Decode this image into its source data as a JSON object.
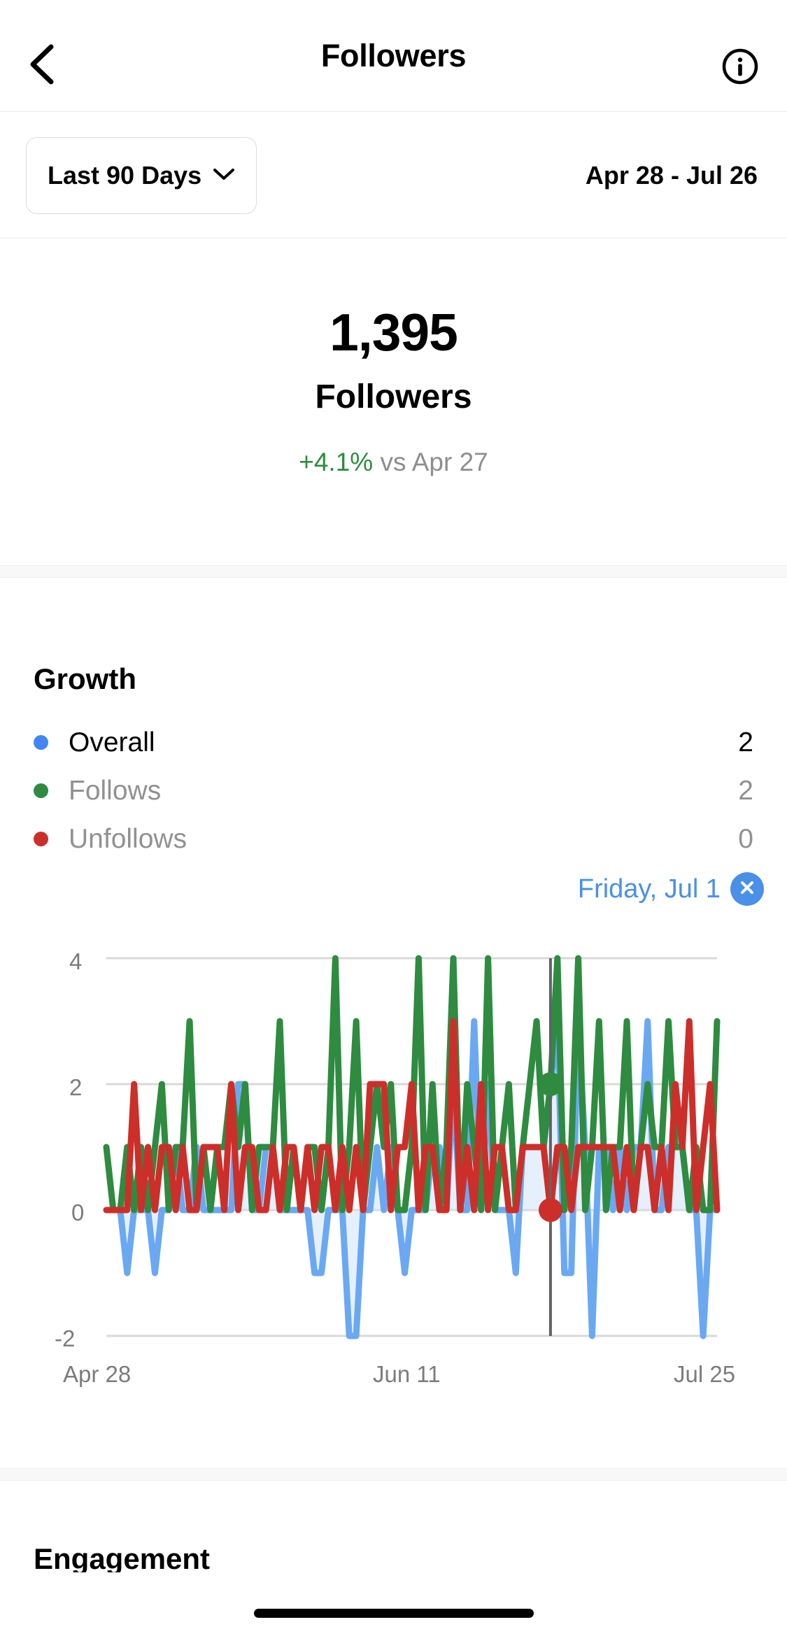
{
  "nav": {
    "back_icon": "chevron-left-icon",
    "title": "Followers",
    "info_icon": "info-circle-icon"
  },
  "filter": {
    "range_label": "Last 90 Days",
    "chevron_icon": "chevron-down-icon",
    "date_range": "Apr 28 - Jul 26"
  },
  "hero": {
    "value": "1,395",
    "label": "Followers",
    "delta_pct": "+4.1%",
    "delta_suffix": " vs Apr 27",
    "delta_color": "#2e8b40"
  },
  "growth": {
    "title": "Growth",
    "legend": [
      {
        "name": "Overall",
        "value": "2",
        "color": "#4285f4",
        "active": true
      },
      {
        "name": "Follows",
        "value": "2",
        "color": "#2e8b40",
        "active": false
      },
      {
        "name": "Unfollows",
        "value": "0",
        "color": "#cc2f2a",
        "active": false
      }
    ],
    "selected_date": "Friday, Jul 1",
    "close_icon": "close-circle-icon",
    "accent_blue": "#4a90e8"
  },
  "next_section": {
    "title": "Engagement"
  },
  "chart_data": {
    "type": "line",
    "title": "Growth",
    "xlabel": "",
    "ylabel": "",
    "ylim": [
      -2,
      4
    ],
    "yticks": [
      -2,
      0,
      2,
      4
    ],
    "ytick_labels": [
      "-2",
      "0",
      "2",
      "4"
    ],
    "grid": true,
    "legend_position": "above-chart",
    "x_tick_labels": [
      "Apr 28",
      "Jun 11",
      "Jul 25"
    ],
    "x_tick_indices": [
      0,
      44,
      88
    ],
    "x_start": "Apr 28",
    "x_end": "Jul 25",
    "n_points": 89,
    "highlight": {
      "label": "Friday, Jul 1",
      "index": 64,
      "overall": 2,
      "follows": 2,
      "unfollows": 0
    },
    "series": [
      {
        "name": "Overall",
        "color": "#6aa9f2",
        "fill": "#d2e3fb",
        "area": true,
        "values": [
          0,
          0,
          0,
          -1,
          0,
          0,
          0,
          -1,
          0,
          0,
          1,
          0,
          0,
          1,
          0,
          0,
          0,
          0,
          0,
          2,
          2,
          0,
          0,
          1,
          1,
          0,
          0,
          0,
          0,
          0,
          -1,
          -1,
          0,
          0,
          0,
          -2,
          -2,
          0,
          0,
          1,
          0,
          1,
          0,
          -1,
          0,
          0,
          0,
          1,
          1,
          0,
          2,
          0,
          0,
          3,
          0,
          2,
          0,
          0,
          0,
          -1,
          1,
          1,
          1,
          1,
          2,
          3,
          -1,
          -1,
          3,
          1,
          -2,
          1,
          1,
          0,
          1,
          0,
          1,
          1,
          3,
          0,
          0,
          1,
          1,
          1,
          0,
          0,
          -2,
          0,
          0
        ]
      },
      {
        "name": "Follows",
        "color": "#2e8b40",
        "values": [
          1,
          0,
          0,
          1,
          0,
          1,
          0,
          1,
          2,
          0,
          1,
          1,
          3,
          0,
          1,
          0,
          1,
          1,
          2,
          1,
          2,
          0,
          1,
          1,
          1,
          3,
          0,
          1,
          0,
          1,
          1,
          0,
          1,
          4,
          0,
          1,
          3,
          0,
          1,
          2,
          1,
          2,
          0,
          0,
          1,
          4,
          0,
          2,
          0,
          1,
          4,
          0,
          2,
          1,
          0,
          4,
          0,
          1,
          2,
          0,
          1,
          2,
          3,
          1,
          2,
          4,
          0,
          1,
          4,
          0,
          1,
          3,
          0,
          1,
          1,
          3,
          0,
          1,
          2,
          1,
          1,
          3,
          1,
          1,
          0,
          1,
          0,
          0,
          3
        ]
      },
      {
        "name": "Unfollows",
        "color": "#cc2f2a",
        "values": [
          0,
          0,
          0,
          0,
          2,
          0,
          1,
          0,
          1,
          1,
          0,
          1,
          0,
          0,
          1,
          1,
          1,
          0,
          2,
          0,
          1,
          1,
          0,
          0,
          1,
          0,
          1,
          1,
          0,
          1,
          0,
          1,
          1,
          0,
          1,
          0,
          1,
          0,
          2,
          2,
          2,
          0,
          1,
          1,
          2,
          0,
          1,
          1,
          0,
          0,
          3,
          0,
          1,
          0,
          2,
          0,
          1,
          1,
          0,
          0,
          1,
          1,
          1,
          1,
          0,
          1,
          1,
          0,
          1,
          1,
          1,
          1,
          1,
          1,
          0,
          1,
          0,
          1,
          1,
          0,
          1,
          0,
          2,
          1,
          3,
          0,
          1,
          2,
          0
        ]
      }
    ]
  }
}
